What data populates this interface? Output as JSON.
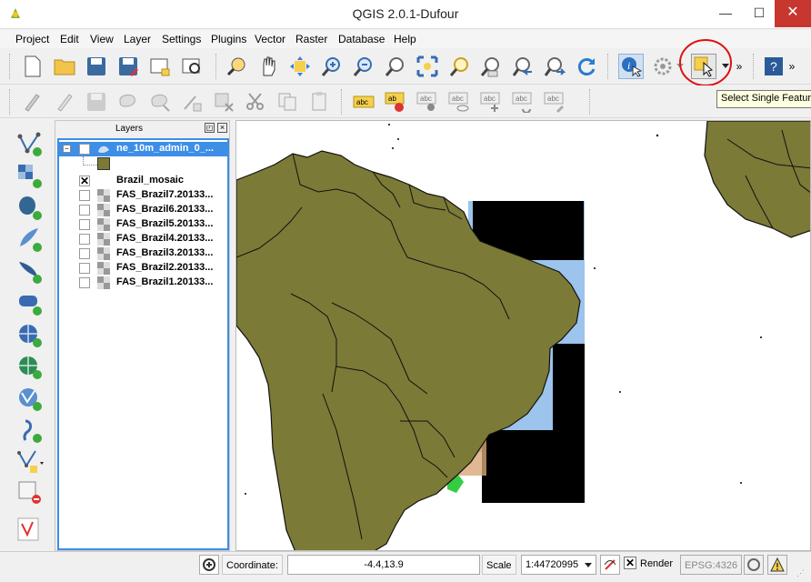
{
  "window": {
    "title": "QGIS 2.0.1-Dufour",
    "minimize": "—",
    "maximize": "☐",
    "close": "✕"
  },
  "menu": [
    "Project",
    "Edit",
    "View",
    "Layer",
    "Settings",
    "Plugins",
    "Vector",
    "Raster",
    "Database",
    "Help"
  ],
  "toolbar": {
    "overflow": "»",
    "tooltip": "Select Single Feature"
  },
  "layers_panel": {
    "title": "Layers",
    "layers": [
      {
        "name": "ne_10m_admin_0_...",
        "checked": true,
        "type": "vector",
        "color": "#7b7a37",
        "expanded": true
      },
      {
        "name": "Brazil_mosaic",
        "checked": true,
        "type": "raster"
      },
      {
        "name": "FAS_Brazil7.20133...",
        "checked": false,
        "type": "raster"
      },
      {
        "name": "FAS_Brazil6.20133...",
        "checked": false,
        "type": "raster"
      },
      {
        "name": "FAS_Brazil5.20133...",
        "checked": false,
        "type": "raster"
      },
      {
        "name": "FAS_Brazil4.20133...",
        "checked": false,
        "type": "raster"
      },
      {
        "name": "FAS_Brazil3.20133...",
        "checked": false,
        "type": "raster"
      },
      {
        "name": "FAS_Brazil2.20133...",
        "checked": false,
        "type": "raster"
      },
      {
        "name": "FAS_Brazil1.20133...",
        "checked": false,
        "type": "raster"
      }
    ]
  },
  "status": {
    "coordinate_label": "Coordinate:",
    "coordinate_value": "-4.4,13.9",
    "scale_label": "Scale",
    "scale_value": "1:44720995",
    "render_label": "Render",
    "epsg": "EPSG:4326"
  },
  "colors": {
    "land": "#7b7a37",
    "water": "#9cc4ec",
    "selected": "#3d8ee6",
    "highlight": "#d11"
  }
}
